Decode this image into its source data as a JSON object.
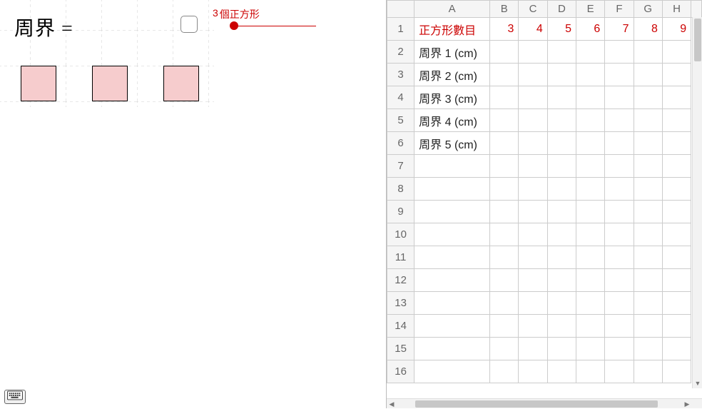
{
  "canvas": {
    "perimeter_label": "周界 =",
    "checkbox_checked": false,
    "slider": {
      "value": "3",
      "unit": "個正方形"
    },
    "squares": 3
  },
  "spreadsheet": {
    "columns": [
      "A",
      "B",
      "C",
      "D",
      "E",
      "F",
      "G",
      "H"
    ],
    "row_numbers": [
      1,
      2,
      3,
      4,
      5,
      6,
      7,
      8,
      9,
      10,
      11,
      12,
      13,
      14,
      15,
      16
    ],
    "rows": [
      {
        "a": "正方形數目",
        "a_red": true,
        "cells": [
          "3",
          "4",
          "5",
          "6",
          "7",
          "8",
          "9"
        ],
        "cells_red": true
      },
      {
        "a": "周界 1 (cm)",
        "cells": [
          "",
          "",
          "",
          "",
          "",
          "",
          ""
        ]
      },
      {
        "a": "周界 2 (cm)",
        "cells": [
          "",
          "",
          "",
          "",
          "",
          "",
          ""
        ]
      },
      {
        "a": "周界 3 (cm)",
        "cells": [
          "",
          "",
          "",
          "",
          "",
          "",
          ""
        ]
      },
      {
        "a": "周界 4 (cm)",
        "cells": [
          "",
          "",
          "",
          "",
          "",
          "",
          ""
        ]
      },
      {
        "a": "周界 5 (cm)",
        "cells": [
          "",
          "",
          "",
          "",
          "",
          "",
          ""
        ]
      },
      {
        "a": "",
        "cells": [
          "",
          "",
          "",
          "",
          "",
          "",
          ""
        ]
      },
      {
        "a": "",
        "cells": [
          "",
          "",
          "",
          "",
          "",
          "",
          ""
        ]
      },
      {
        "a": "",
        "cells": [
          "",
          "",
          "",
          "",
          "",
          "",
          ""
        ]
      },
      {
        "a": "",
        "cells": [
          "",
          "",
          "",
          "",
          "",
          "",
          ""
        ]
      },
      {
        "a": "",
        "cells": [
          "",
          "",
          "",
          "",
          "",
          "",
          ""
        ]
      },
      {
        "a": "",
        "cells": [
          "",
          "",
          "",
          "",
          "",
          "",
          ""
        ]
      },
      {
        "a": "",
        "cells": [
          "",
          "",
          "",
          "",
          "",
          "",
          ""
        ]
      },
      {
        "a": "",
        "cells": [
          "",
          "",
          "",
          "",
          "",
          "",
          ""
        ]
      },
      {
        "a": "",
        "cells": [
          "",
          "",
          "",
          "",
          "",
          "",
          ""
        ]
      },
      {
        "a": "",
        "cells": [
          "",
          "",
          "",
          "",
          "",
          "",
          ""
        ]
      }
    ]
  }
}
